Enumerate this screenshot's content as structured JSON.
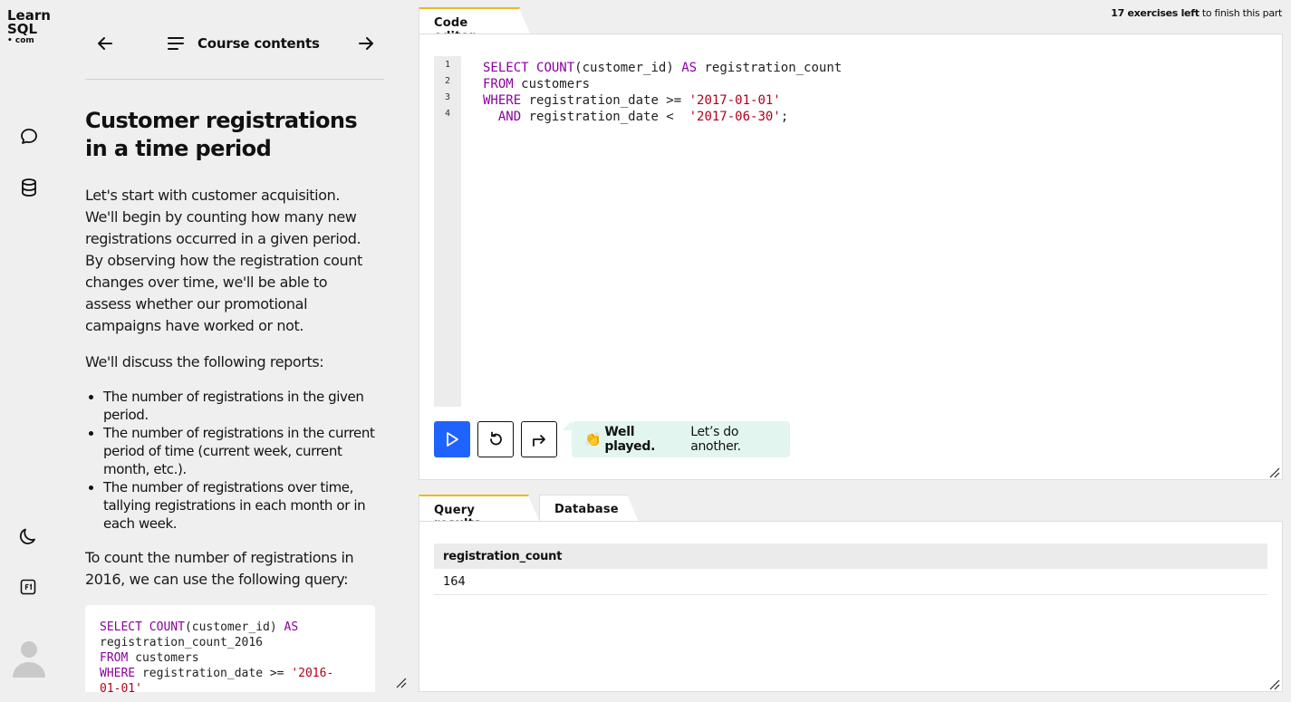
{
  "logo": {
    "line1": "Learn",
    "line2": "SQL",
    "line3": "• com"
  },
  "nav": {
    "contents_label": "Course contents"
  },
  "lesson": {
    "title": "Customer registrations in a time period",
    "intro": "Let's start with customer acquisition. We'll begin by counting how many new registrations occurred in a given period. By observing how the registration count changes over time, we'll be able to assess whether our promotional campaigns have worked or not.",
    "reports_intro": "We'll discuss the following reports:",
    "reports": [
      "The number of registrations in the given period.",
      "The number of registrations in the current period of time (current week, current month, etc.).",
      "The number of registrations over time, tallying registrations in each month or in each week."
    ],
    "query_intro": "To count the number of registrations in 2016, we can use the following query:",
    "example": {
      "kw1": "SELECT",
      "fn1": "COUNT",
      "t1": "(customer_id) ",
      "kw2": "AS",
      "t2": "registration_count_2016",
      "kw3": "FROM",
      "t3": " customers",
      "kw4": "WHERE",
      "t4": " registration_date >= ",
      "s1": "'2016-",
      "s2": "01-01'"
    }
  },
  "editor": {
    "tab_label": "Code editor",
    "exercises_left_bold": "17 exercises left",
    "exercises_left_rest": " to finish this part",
    "line_numbers": [
      "1",
      "2",
      "3",
      "4"
    ],
    "code": {
      "l1_kw": "SELECT",
      "l1_fn": "COUNT",
      "l1_rest": "(customer_id) ",
      "l1_kw2": "AS",
      "l1_end": " registration_count",
      "l2_kw": "FROM",
      "l2_rest": " customers",
      "l3_kw": "WHERE",
      "l3_rest": " registration_date >= ",
      "l3_str": "'2017-01-01'",
      "l4_kw": "AND",
      "l4_rest": " registration_date <  ",
      "l4_str": "'2017-06-30'",
      "l4_end": ";"
    },
    "toast_emoji": "👏",
    "toast_bold": "Well played.",
    "toast_rest": "Let’s do another."
  },
  "results": {
    "tab_results": "Query results",
    "tab_database": "Database",
    "columns": [
      "registration_count"
    ],
    "rows": [
      [
        "164"
      ]
    ]
  },
  "colors": {
    "run_button": "#1f63ff",
    "active_tab_accent": "#f0b71a",
    "toast_bg": "#e2f6ef",
    "keyword": "#8a009e",
    "string": "#b0001a"
  }
}
